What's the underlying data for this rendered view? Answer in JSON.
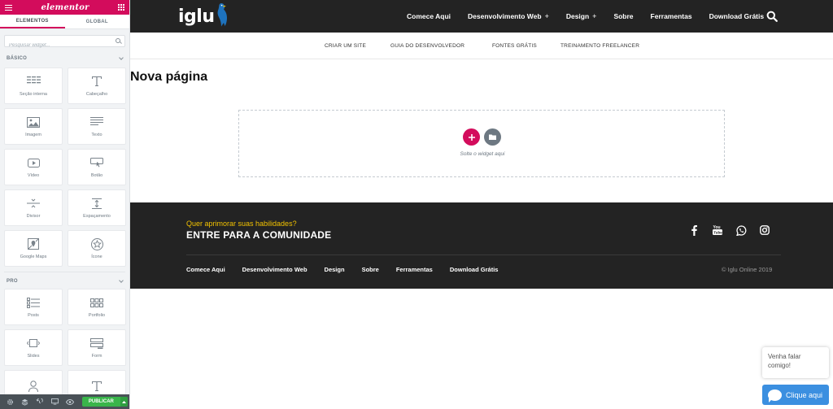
{
  "panel": {
    "logo": "elementor",
    "tabs": [
      "ELEMENTOS",
      "GLOBAL"
    ],
    "search_placeholder": "Pesquisar widget...",
    "categories": [
      {
        "title": "BÁSICO",
        "widgets": [
          "Seção interna",
          "Cabeçalho",
          "Imagem",
          "Texto",
          "Vídeo",
          "Botão",
          "Divisor",
          "Espaçamento",
          "Google Maps",
          "Ícone"
        ]
      },
      {
        "title": "PRO",
        "widgets": [
          "Posts",
          "Portfolio",
          "Slides",
          "Form",
          "",
          ""
        ]
      }
    ],
    "footer": {
      "publish_label": "PUBLICAR"
    }
  },
  "site": {
    "brand": "iglu",
    "menu": [
      {
        "label": "Comece Aqui",
        "plus": false
      },
      {
        "label": "Desenvolvimento Web",
        "plus": true
      },
      {
        "label": "Design",
        "plus": true
      },
      {
        "label": "Sobre",
        "plus": false
      },
      {
        "label": "Ferramentas",
        "plus": false
      },
      {
        "label": "Download Grátis",
        "plus": false
      }
    ],
    "submenu": [
      "CRIAR UM SITE",
      "GUIA DO DESENVOLVEDOR",
      "FONTES GRÁTIS",
      "TREINAMENTO FREELANCER"
    ],
    "page_title": "Nova página",
    "dropzone_text": "Solte o widget aqui",
    "footer": {
      "tagline": "Quer aprimorar suas habilidades?",
      "heading": "ENTRE PARA A COMUNIDADE",
      "links": [
        "Comece Aqui",
        "Desenvolvimento Web",
        "Design",
        "Sobre",
        "Ferramentas",
        "Download Grátis"
      ],
      "copyright": "© Iglu Online 2019"
    }
  },
  "chat": {
    "bubble": "Venha falar comigo!",
    "button": "Clique aqui"
  },
  "colors": {
    "elementor_accent": "#d30c5c",
    "nav_bg": "#232323",
    "publish_green": "#39b54a",
    "chat_blue": "#3b8fe0",
    "footer_tagline": "#f2c200"
  }
}
